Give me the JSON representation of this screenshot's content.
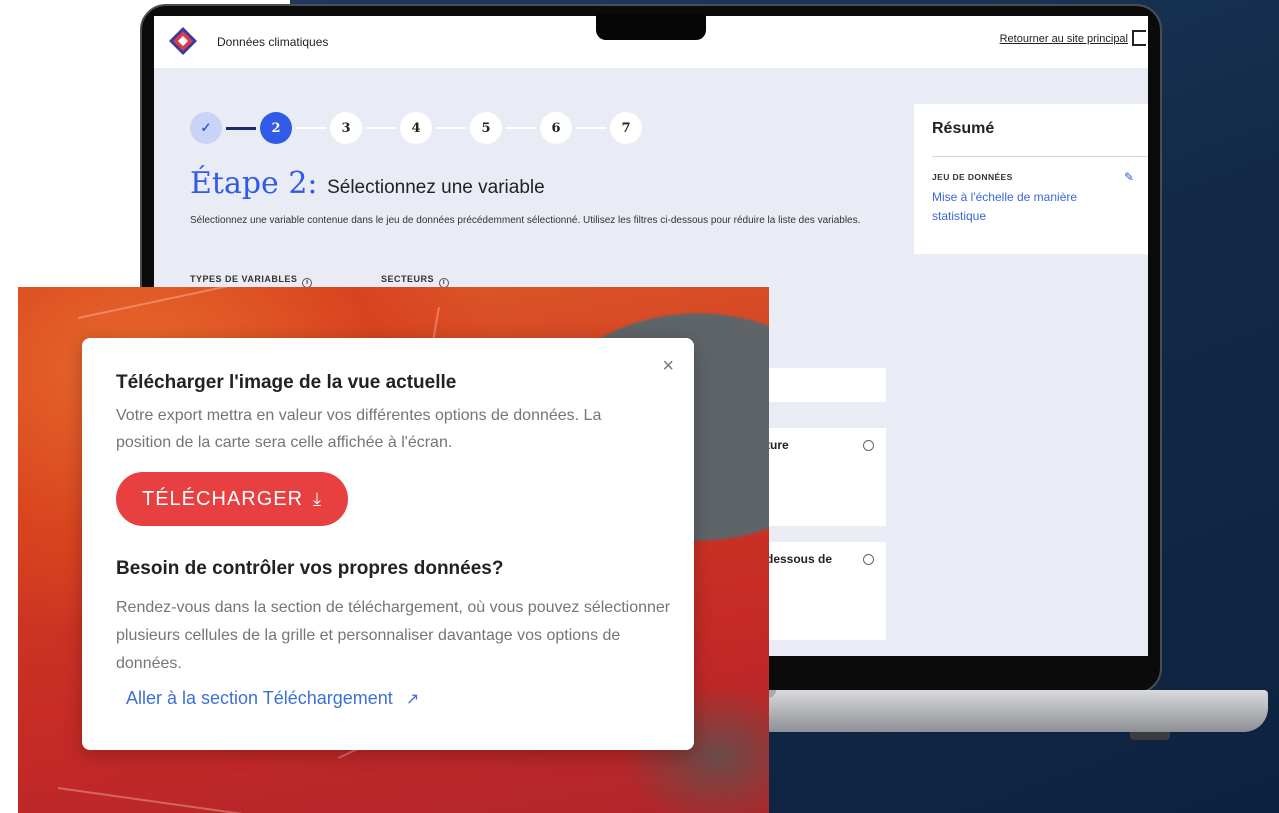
{
  "header": {
    "app_title": "Données climatiques",
    "back_link": "Retourner au site principal"
  },
  "stepper": {
    "steps": [
      "✓",
      "2",
      "3",
      "4",
      "5",
      "6",
      "7"
    ]
  },
  "step": {
    "title_prefix": "Étape 2:",
    "title_text": "Sélectionnez une variable",
    "description": "Sélectionnez une variable contenue dans le jeu de données précédemment sélectionné. Utilisez les filtres ci-dessous pour réduire la liste des variables."
  },
  "filters": {
    "variable_types": "TYPES DE VARIABLES",
    "sectors": "SECTEURS"
  },
  "cards": [
    {
      "label": "ture"
    },
    {
      "label": "dessous de"
    }
  ],
  "summary": {
    "title": "Résumé",
    "dataset_label": "JEU DE DONNÉES",
    "dataset_value": "Mise à l'échelle de manière statistique"
  },
  "modal": {
    "close": "×",
    "title": "Télécharger l'image de la vue actuelle",
    "text": "Votre export mettra en valeur vos différentes options de données. La position de la carte sera celle affichée à l'écran.",
    "download_button": "TÉLÉCHARGER",
    "subtitle": "Besoin de contrôler vos propres données?",
    "subtext": "Rendez-vous dans la section de téléchargement, où vous pouvez sélectionner plusieurs cellules de la grille et personnaliser davantage vos options de données.",
    "link": "Aller à la section Téléchargement"
  },
  "colors": {
    "accent_blue": "#2f5be7",
    "download_red": "#e84040",
    "link_blue": "#3d6fd8"
  }
}
